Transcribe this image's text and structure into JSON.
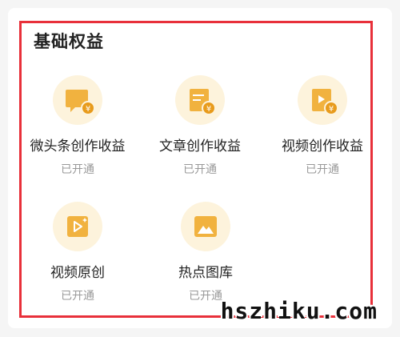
{
  "section": {
    "title": "基础权益"
  },
  "benefits": [
    {
      "label": "微头条创作收益",
      "status": "已开通",
      "icon": "micro-headline-yuan-icon"
    },
    {
      "label": "文章创作收益",
      "status": "已开通",
      "icon": "article-yuan-icon"
    },
    {
      "label": "视频创作收益",
      "status": "已开通",
      "icon": "video-yuan-icon"
    },
    {
      "label": "视频原创",
      "status": "已开通",
      "icon": "video-original-icon"
    },
    {
      "label": "热点图库",
      "status": "已开通",
      "icon": "image-gallery-icon"
    }
  ],
  "watermark": "hszhiku.com",
  "colors": {
    "highlight_border": "#e8303a",
    "icon_gold": "#f1b23f",
    "icon_bg": "#fdf3dc"
  }
}
